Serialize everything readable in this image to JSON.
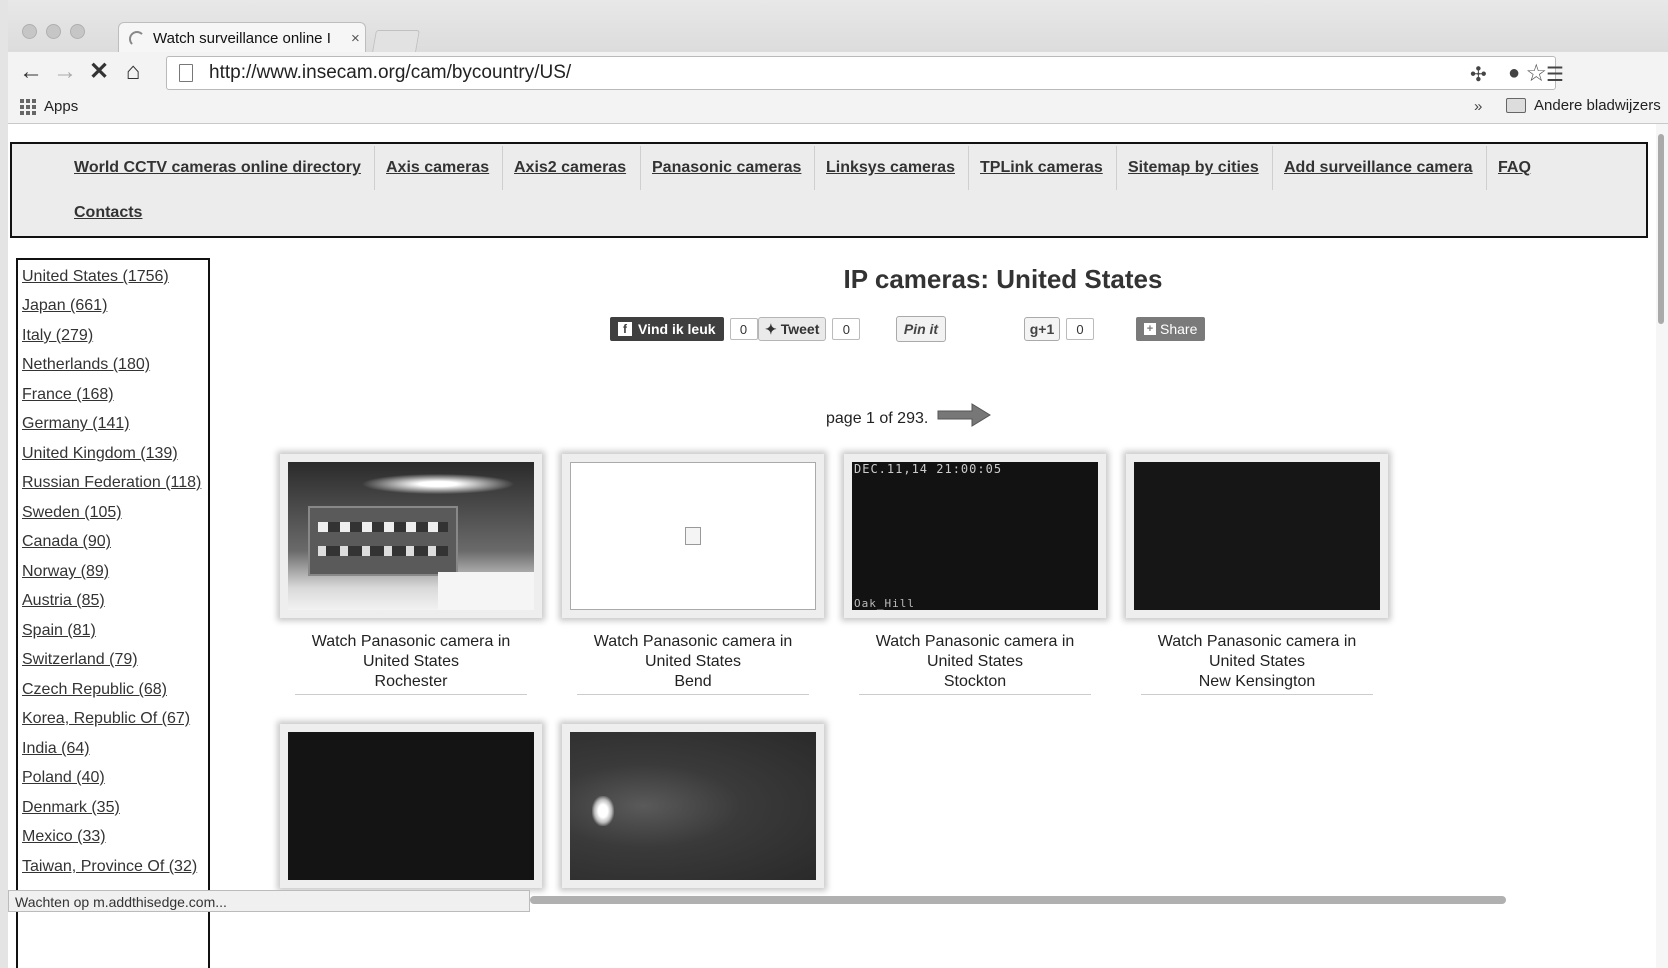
{
  "browser": {
    "tab_title": "Watch surveillance online I",
    "tab_close": "×",
    "url": "http://www.insecam.org/cam/bycountry/US/",
    "bookmarks_apps": "Apps",
    "bookmarks_more": "»",
    "bookmarks_other": "Andere bladwijzers",
    "status": "Wachten op m.addthisedge.com..."
  },
  "nav": {
    "items": [
      "World CCTV cameras online directory",
      "Axis cameras",
      "Axis2 cameras",
      "Panasonic cameras",
      "Linksys cameras",
      "TPLink cameras",
      "Sitemap by cities",
      "Add surveillance camera",
      "FAQ",
      "Contacts"
    ]
  },
  "sidebar": {
    "countries": [
      "United States (1756)",
      "Japan (661)",
      "Italy (279)",
      "Netherlands (180)",
      "France (168)",
      "Germany (141)",
      "United Kingdom (139)",
      "Russian Federation (118)",
      "Sweden (105)",
      "Canada (90)",
      "Norway (89)",
      "Austria (85)",
      "Spain (81)",
      "Switzerland (79)",
      "Czech Republic (68)",
      "Korea, Republic Of (67)",
      "India (64)",
      "Poland (40)",
      "Denmark (35)",
      "Mexico (33)",
      "Taiwan, Province Of (32)"
    ]
  },
  "main": {
    "heading": "IP cameras: United States",
    "social": {
      "facebook_label": "Vind ik leuk",
      "facebook_count": "0",
      "tweet_label": "Tweet",
      "tweet_count": "0",
      "pin_label": "Pin it",
      "gplus_label": "g+1",
      "gplus_count": "0",
      "share_label": "Share"
    },
    "pager": "page 1 of 293.",
    "cameras": [
      {
        "line1": "Watch Panasonic camera in",
        "line2": "United States",
        "city": "Rochester"
      },
      {
        "line1": "Watch Panasonic camera in",
        "line2": "United States",
        "city": "Bend"
      },
      {
        "line1": "Watch Panasonic camera in",
        "line2": "United States",
        "city": "Stockton",
        "overlay_top": "DEC.11,14 21:00:05",
        "overlay_bottom": "Oak_Hill"
      },
      {
        "line1": "Watch Panasonic camera in",
        "line2": "United States",
        "city": "New Kensington"
      },
      {},
      {}
    ]
  },
  "icons": {
    "back": "back-arrow-icon",
    "forward": "forward-arrow-icon",
    "stop": "stop-icon",
    "home": "home-icon",
    "star": "star-icon",
    "menu": "menu-icon",
    "next": "next-page-arrow-icon"
  }
}
